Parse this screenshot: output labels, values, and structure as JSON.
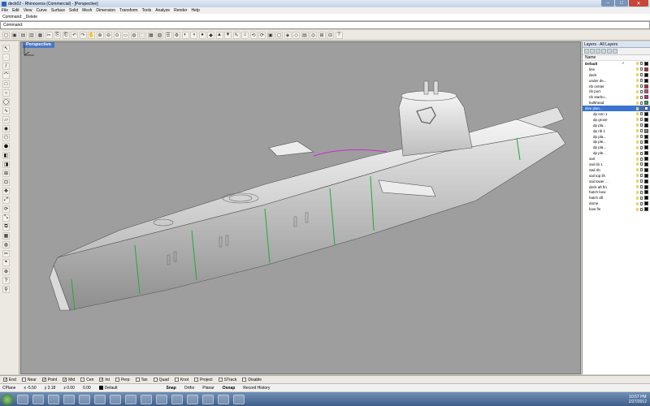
{
  "titlebar": {
    "title": "deck02 - Rhinoceros (Commercial) - [Perspective]"
  },
  "menu": [
    "File",
    "Edit",
    "View",
    "Curve",
    "Surface",
    "Solid",
    "Mesh",
    "Dimension",
    "Transform",
    "Tools",
    "Analyze",
    "Render",
    "Help"
  ],
  "command": {
    "history": "Command: _Delete",
    "prompt": "Command:"
  },
  "viewport": {
    "tab": "Perspective"
  },
  "layers": {
    "panel_title": "Layers - All Layers",
    "col_name": "Name",
    "items": [
      {
        "name": "Default",
        "color": "#000000",
        "indent": 0,
        "check": "✓",
        "bold": true
      },
      {
        "name": "line",
        "color": "#d02020",
        "indent": 1
      },
      {
        "name": "deck",
        "color": "#000000",
        "indent": 1
      },
      {
        "name": "under de...",
        "color": "#000000",
        "indent": 1
      },
      {
        "name": "rib center",
        "color": "#cc2222",
        "indent": 1
      },
      {
        "name": "rib port",
        "color": "#d040b0",
        "indent": 1
      },
      {
        "name": "rib starbo...",
        "color": "#c02090",
        "indent": 1
      },
      {
        "name": "bulkhead",
        "color": "#22aa33",
        "indent": 1
      },
      {
        "name": "dive plan...",
        "color": "#ffffff",
        "indent": 0,
        "selected": true
      },
      {
        "name": "dp eon 1",
        "color": "#000000",
        "indent": 2
      },
      {
        "name": "dp grove",
        "color": "#000000",
        "indent": 2
      },
      {
        "name": "dp pla...",
        "color": "#000000",
        "indent": 2
      },
      {
        "name": "dp rib 1",
        "color": "#777777",
        "indent": 2
      },
      {
        "name": "dp pla...",
        "color": "#000000",
        "indent": 2
      },
      {
        "name": "dp ple...",
        "color": "#000000",
        "indent": 2
      },
      {
        "name": "dp pla...",
        "color": "#000000",
        "indent": 2
      },
      {
        "name": "dp ple...",
        "color": "#000000",
        "indent": 2
      },
      {
        "name": "sail",
        "color": "#000000",
        "indent": 1
      },
      {
        "name": "sail rib 1",
        "color": "#000000",
        "indent": 1
      },
      {
        "name": "Sail rib",
        "color": "#000000",
        "indent": 1
      },
      {
        "name": "sail top lih",
        "color": "#000000",
        "indent": 1
      },
      {
        "name": "sail lower ...",
        "color": "#000000",
        "indent": 1
      },
      {
        "name": "deck aft fin",
        "color": "#000000",
        "indent": 1
      },
      {
        "name": "hatch bow",
        "color": "#000000",
        "indent": 1
      },
      {
        "name": "hatch aft",
        "color": "#000000",
        "indent": 1
      },
      {
        "name": "dome",
        "color": "#000000",
        "indent": 1
      },
      {
        "name": "bow fin",
        "color": "#000000",
        "indent": 1
      }
    ]
  },
  "osnap": [
    {
      "label": "End",
      "checked": true
    },
    {
      "label": "Near",
      "checked": false
    },
    {
      "label": "Point",
      "checked": true
    },
    {
      "label": "Mid",
      "checked": true
    },
    {
      "label": "Cen",
      "checked": false
    },
    {
      "label": "Int",
      "checked": true
    },
    {
      "label": "Perp",
      "checked": false
    },
    {
      "label": "Tan",
      "checked": false
    },
    {
      "label": "Quad",
      "checked": false
    },
    {
      "label": "Knot",
      "checked": false
    },
    {
      "label": "Project",
      "checked": false
    },
    {
      "label": "STrack",
      "checked": false
    },
    {
      "label": "Disable",
      "checked": false
    }
  ],
  "status": {
    "cplane": "CPlane",
    "x": "x -5.50",
    "y": "y 3.18",
    "z": "z 0.00",
    "dist": "0.00",
    "layer": "Default",
    "toggles": [
      "Snap",
      "Ortho",
      "Planar",
      "Osnap",
      "Record History"
    ]
  },
  "clock": {
    "time": "10:57 PM",
    "date": "2/27/2012"
  }
}
